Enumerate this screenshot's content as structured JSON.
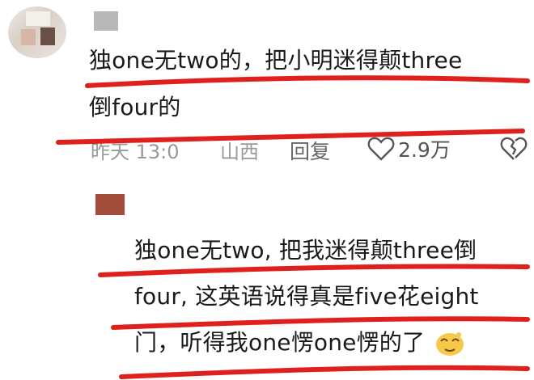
{
  "comment": {
    "line1": "独one无two的，把小明迷得颠three",
    "line2": "倒four的",
    "time": "昨天 13:0",
    "location": "山西",
    "reply_label": "回复",
    "like_count": "2.9万"
  },
  "reply": {
    "line1": "独one无two, 把我迷得颠three倒",
    "line2": "four, 这英语说得真是five花eight",
    "line3": "门，听得我one愣one愣的了"
  },
  "icons": {
    "like": "heart-outline-icon",
    "dislike": "broken-heart-icon",
    "emoji": "dizzy-face-emoji"
  },
  "colors": {
    "underline": "#e0201c",
    "meta_text": "#999999"
  }
}
